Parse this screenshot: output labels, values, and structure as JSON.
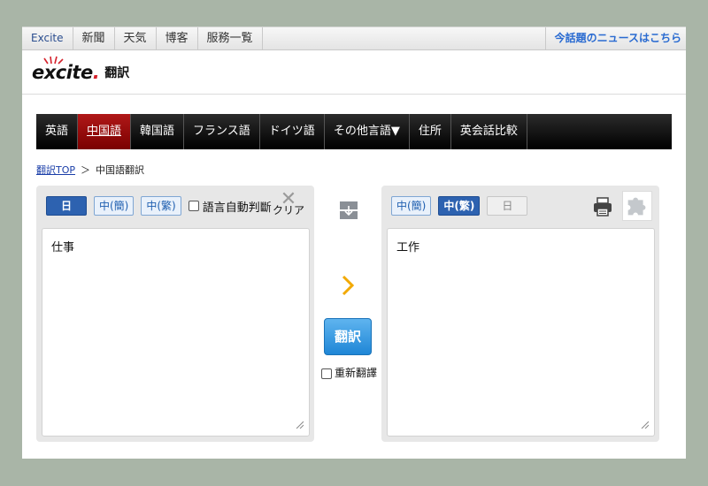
{
  "topbar": {
    "links": [
      "Excite",
      "新聞",
      "天気",
      "博客",
      "服務一覧"
    ],
    "news_link": "今話題のニュースはこちら"
  },
  "logo": {
    "wordmark": "excite",
    "dot": ".",
    "service": "翻訳"
  },
  "langnav": {
    "items": [
      "英語",
      "中国語",
      "韓国語",
      "フランス語",
      "ドイツ語",
      "その他言語▼",
      "住所",
      "英会話比較"
    ],
    "active_index": 1
  },
  "breadcrumb": {
    "home": "翻訳TOP",
    "separator": "＞",
    "current": "中国語翻訳"
  },
  "source": {
    "buttons": [
      "日",
      "中(簡)",
      "中(繁)"
    ],
    "selected": "日",
    "auto_detect_label": "語言自動判斷",
    "auto_detect_checked": false,
    "clear_label": "クリア",
    "text": "仕事"
  },
  "target": {
    "buttons": [
      "中(簡)",
      "中(繁)",
      "日"
    ],
    "selected": "中(繁)",
    "text": "工作"
  },
  "middle": {
    "translate_label": "翻訳",
    "retranslate_label": "重新翻譯",
    "retranslate_checked": false
  },
  "colors": {
    "accent_blue": "#2d62b0",
    "active_tab_red": "#9e1010",
    "translate_button": "#1f86d6",
    "link_blue": "#2a6bd1"
  }
}
